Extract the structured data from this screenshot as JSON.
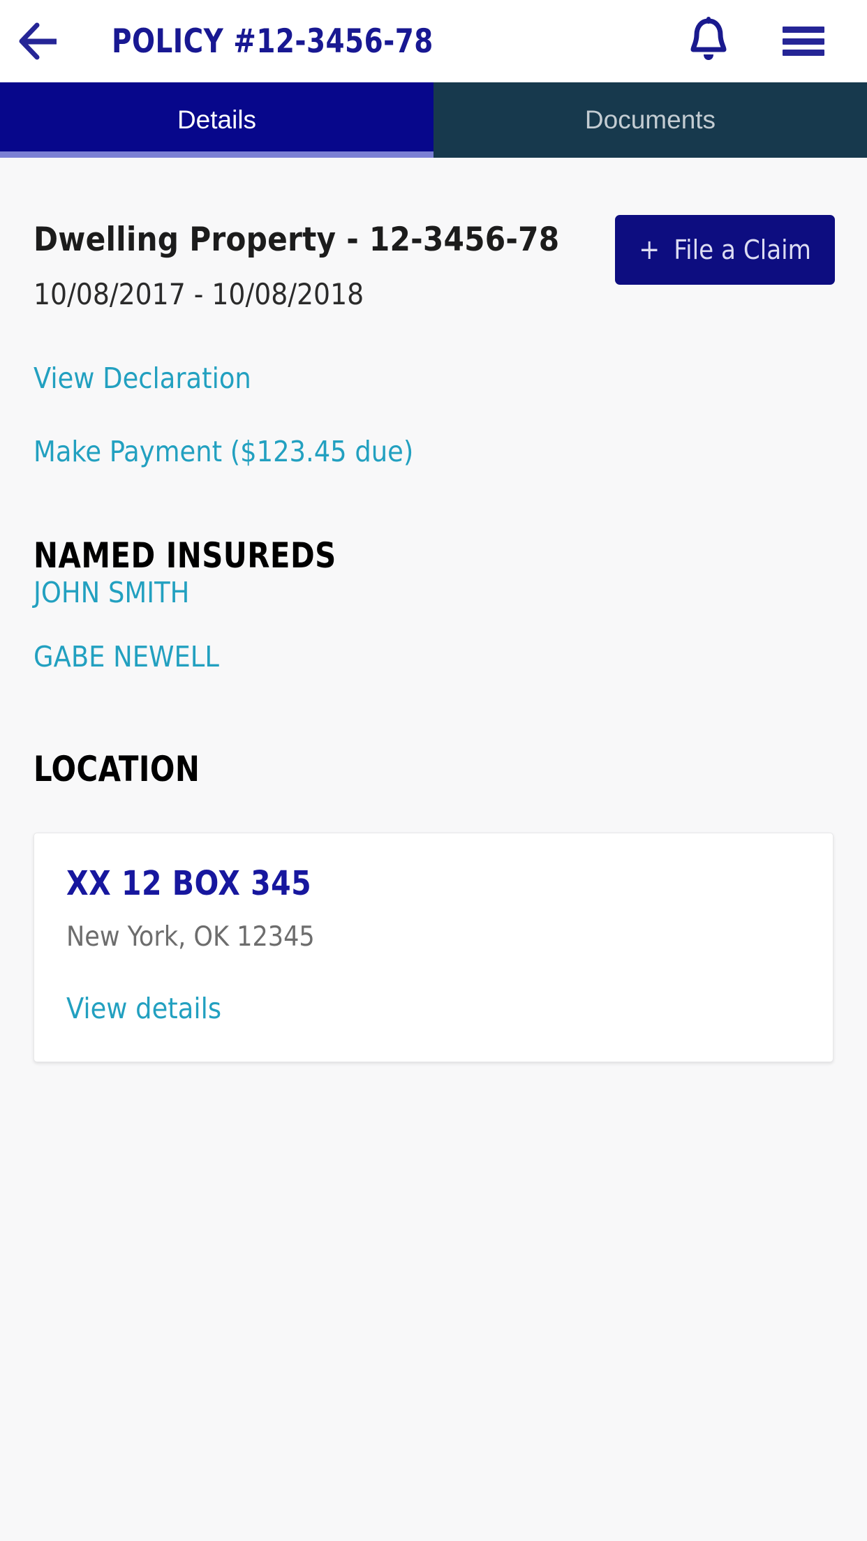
{
  "colors": {
    "brand_navy": "#181892",
    "tab_active_bg": "#07078b",
    "tab_inactive_bg": "#17394d",
    "tab_underline": "#7b80d4",
    "link_cyan": "#22a0c0",
    "button_navy": "#0d0d80",
    "page_bg": "#f8f8f9",
    "card_bg": "#ffffff",
    "muted_text": "#6d6d6d"
  },
  "appbar": {
    "back_icon": "arrow-left-icon",
    "title": "POLICY #12-3456-78",
    "notifications_icon": "bell-icon",
    "menu_icon": "hamburger-menu-icon"
  },
  "tabs": [
    {
      "label": "Details",
      "active": true
    },
    {
      "label": "Documents",
      "active": false
    }
  ],
  "policy": {
    "title": "Dwelling Property - 12-3456-78",
    "date_range": "10/08/2017 - 10/08/2018",
    "claim_button": {
      "plus": "+",
      "label": "File a Claim",
      "icon": "plus-icon"
    },
    "links": [
      {
        "label": "View Declaration"
      },
      {
        "label": "Make Payment ($123.45 due)"
      }
    ],
    "amount_due": "$123.45"
  },
  "named_insureds": {
    "heading": "NAMED INSUREDS",
    "items": [
      {
        "name": "JOHN SMITH"
      },
      {
        "name": "GABE NEWELL"
      }
    ]
  },
  "location": {
    "heading": "LOCATION",
    "card": {
      "address_line1": "XX 12 BOX 345",
      "address_line2": "New York, OK 12345",
      "details_link": "View details"
    }
  }
}
